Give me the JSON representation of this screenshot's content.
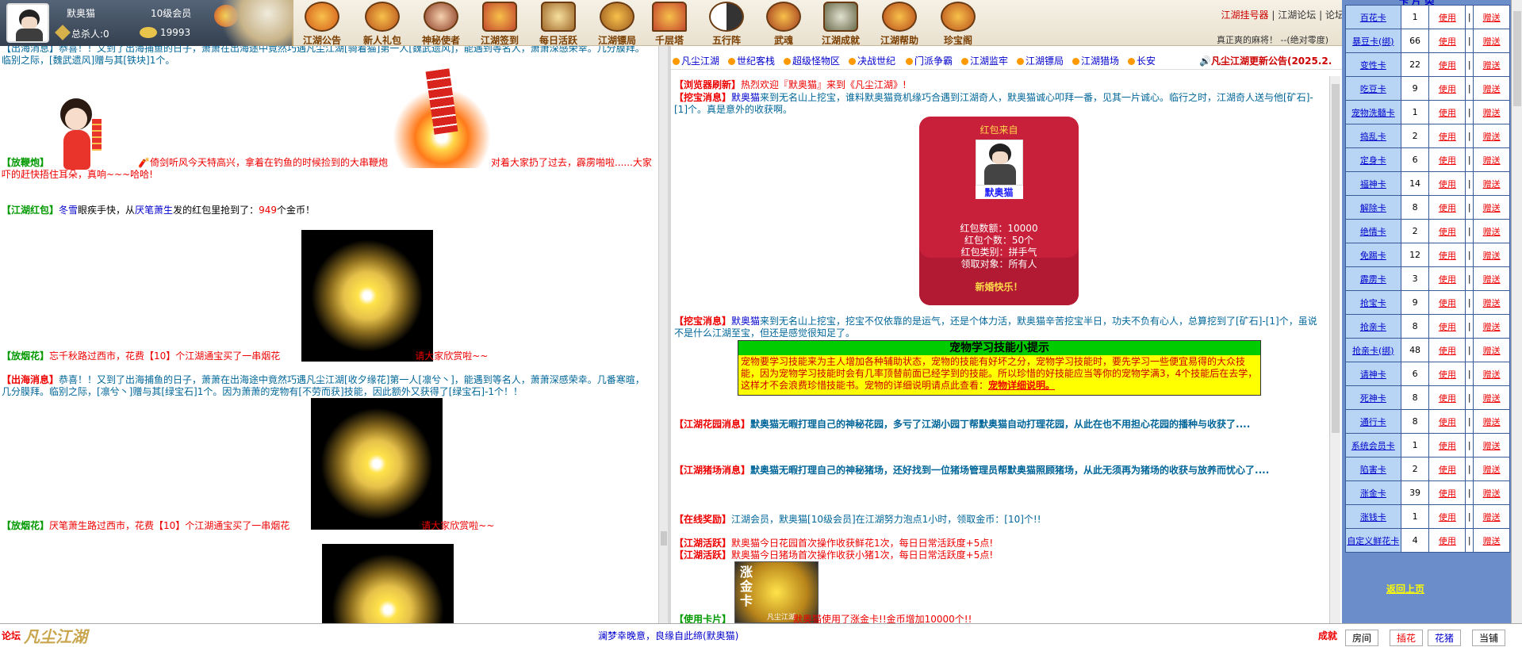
{
  "user": {
    "name": "默奥猫",
    "level": "10级会员",
    "kills_label": "总杀人:0",
    "gold": "19993"
  },
  "nav": [
    {
      "label": "江湖公告",
      "color": "#d45a1a"
    },
    {
      "label": "新人礼包",
      "color": "#b8501b"
    },
    {
      "label": "神秘使者",
      "color": "#8a3a20"
    },
    {
      "label": "江湖签到",
      "color": "#c4492e"
    },
    {
      "label": "每日活跃",
      "color": "#a06a2a"
    },
    {
      "label": "江湖镖局",
      "color": "#9a5a20"
    },
    {
      "label": "千层塔",
      "color": "#c4492e"
    },
    {
      "label": "五行阵",
      "color": "#555555"
    },
    {
      "label": "武魂",
      "color": "#a03a20"
    },
    {
      "label": "江湖成就",
      "color": "#6a6a4a"
    },
    {
      "label": "江湖帮助",
      "color": "#b84a1a"
    },
    {
      "label": "珍宝阁",
      "color": "#b8501b"
    }
  ],
  "top_links": {
    "guaji": "江湖挂号器",
    "sep1": "|",
    "forum": "江湖论坛",
    "sep2": "|",
    "shop": "论坛积分商店"
  },
  "motto": "真正爽的麻将！ --(绝对零度)",
  "left_messages": {
    "m0": "【出海消息】恭喜！！又到了出海捕鱼的日子，萧萧在出海途中竟然巧遇凡尘江湖[骑着猫]第一人[魏武遗风]，能遇到等名人，萧萧深感荣幸。几分膜拜。临别之际，[魏武遗风]赠与其[铁块]1个。",
    "m1_tag": "【放鞭炮】",
    "m1_text": "倚剑听风今天特高兴，拿着在钓鱼的时候捡到的大串鞭炮",
    "m1_tail": "对着大家扔了过去，霹雳啪啦......大家吓的赶快捂住耳朵，真响~~~哈哈!",
    "m2_tag": "【江湖红包】",
    "m2_name": "冬雪",
    "m2_a": "眼疾手快，从",
    "m2_from": "厌笔萧生",
    "m2_b": "发的红包里抢到了：",
    "m2_num": "949",
    "m2_c": "个金币！",
    "m3_tag": "【放烟花】",
    "m3_text": "忘千秋路过西市，花费【10】个江湖通宝买了一串烟花",
    "m3_tail": "请大家欣赏啦~~",
    "m4_tag": "【出海消息】",
    "m4_text": "恭喜！！又到了出海捕鱼的日子，萧萧在出海途中竟然巧遇凡尘江湖[收夕缘花]第一人[凛兮丶]，能遇到等名人，萧萧深感荣幸。几番寒暄，几分膜拜。临别之际，[凛兮丶]赠与其[绿宝石]1个。因为萧萧的宠物有[不劳而获]技能，因此额外又获得了[绿宝石]-1个！！",
    "m5_tag": "【放烟花】",
    "m5_text": "厌笔萧生路过西市，花费【10】个江湖通宝买了一串烟花",
    "m5_tail": "请大家欣赏啦~~"
  },
  "center_tabs": [
    "凡尘江湖",
    "世纪客栈",
    "超级怪物区",
    "决战世纪",
    "门派争霸",
    "江湖监牢",
    "江湖镖局",
    "江湖猎场",
    "长安"
  ],
  "announce": "凡尘江湖更新公告(2025.2.",
  "center_messages": {
    "c0_tag": "【浏览器刷新】",
    "c0_text": "热烈欢迎『默奥猫』来到《凡尘江湖》!",
    "c1_tag": "【挖宝消息】",
    "c1_name": "默奥猫",
    "c1_text": "来到无名山上挖宝，谁料默奥猫竟机缘巧合遇到江湖奇人，默奥猫诚心叩拜一番，见其一片诚心。临行之时，江湖奇人送与他[矿石]-[1]个。真是意外的收获啊。",
    "c2_tag": "【挖宝消息】",
    "c2_name": "默奥猫",
    "c2_text": "来到无名山上挖宝，挖宝不仅依靠的是运气，还是个体力活，默奥猫辛苦挖宝半日，功夫不负有心人，总算挖到了[矿石]-[1]个，虽说不是什么江湖至宝，但还是感觉很知足了。",
    "c3_tag": "【江湖花园消息】",
    "c3_text": "默奥猫无暇打理自己的神秘花园，多亏了江湖小园丁帮默奥猫自动打理花园，从此在也不用担心花园的播种与收获了....",
    "c4_tag": "【江湖猪场消息】",
    "c4_text": "默奥猫无暇打理自己的神秘猪场，还好找到一位猪场管理员帮默奥猫照顾猪场，从此无须再为猪场的收获与放养而忧心了....",
    "c5_tag": "【在线奖励】",
    "c5_text": "江湖会员，默奥猫[10级会员]在江湖努力泡点1小时，领取金币：[10]个!!",
    "c6_tag": "【江湖活跃】",
    "c6_text": "默奥猫今日花园首次操作收获鲜花1次，每日日常活跃度+5点!",
    "c7_tag": "【江湖活跃】",
    "c7_text": "默奥猫今日猪场首次操作收获小猪1次，每日日常活跃度+5点!",
    "c8_tag": "【使用卡片】",
    "c8_text": "默奥猫使用了涨金卡!!金币增加10000个!!",
    "card_label": "涨金卡",
    "card_footer": "凡尘江湖"
  },
  "envelope": {
    "from": "红包来自",
    "name": "默奥猫",
    "l1": "红包数额：10000",
    "l2": "红包个数：50个",
    "l3": "红包类别：拼手气",
    "l4": "领取对象：所有人",
    "wish": "新婚快乐！"
  },
  "tip": {
    "title": "宠物学习技能小提示",
    "body": "宠物要学习技能来为主人增加各种辅助状态，宠物的技能有好坏之分，宠物学习技能时，要先学习一些便宜易得的大众技能，因为宠物学习技能时会有几率顶替前面已经学到的技能。所以珍惜的好技能应当等你的宠物学满3，4个技能后在去学，这样才不会浪费珍惜技能书。宠物的详细说明请点此查看：",
    "link": "宠物详细说明。"
  },
  "cards": [
    {
      "name": "百花卡",
      "count": "1"
    },
    {
      "name": "暴豆卡(绑)",
      "count": "66"
    },
    {
      "name": "变性卡",
      "count": "22"
    },
    {
      "name": "吃豆卡",
      "count": "9"
    },
    {
      "name": "宠物洗髓卡",
      "count": "1"
    },
    {
      "name": "捣乱卡",
      "count": "2"
    },
    {
      "name": "定身卡",
      "count": "6"
    },
    {
      "name": "福神卡",
      "count": "14"
    },
    {
      "name": "解除卡",
      "count": "8"
    },
    {
      "name": "绝情卡",
      "count": "2"
    },
    {
      "name": "免踢卡",
      "count": "12"
    },
    {
      "name": "霹雳卡",
      "count": "3"
    },
    {
      "name": "抢宝卡",
      "count": "9"
    },
    {
      "name": "抢亲卡",
      "count": "8"
    },
    {
      "name": "抢亲卡(绑)",
      "count": "48"
    },
    {
      "name": "请神卡",
      "count": "6"
    },
    {
      "name": "死神卡",
      "count": "8"
    },
    {
      "name": "通行卡",
      "count": "8"
    },
    {
      "name": "系统会员卡",
      "count": "1"
    },
    {
      "name": "陷害卡",
      "count": "2"
    },
    {
      "name": "涨金卡",
      "count": "39"
    },
    {
      "name": "涨钱卡",
      "count": "1"
    },
    {
      "name": "自定义鲜花卡",
      "count": "4"
    }
  ],
  "card_actions": {
    "use": "使用",
    "sep": "|",
    "give": "赠送"
  },
  "right_header": "卡 片 类",
  "return": "返回上页",
  "status": {
    "forum": "论坛",
    "logo": "凡尘江湖",
    "mid": "澜梦幸晚意，良缘自此缔(默奥猫)",
    "right": "成就"
  },
  "bottom_tabs": [
    "房间",
    "插花",
    "花猪",
    "当铺"
  ]
}
